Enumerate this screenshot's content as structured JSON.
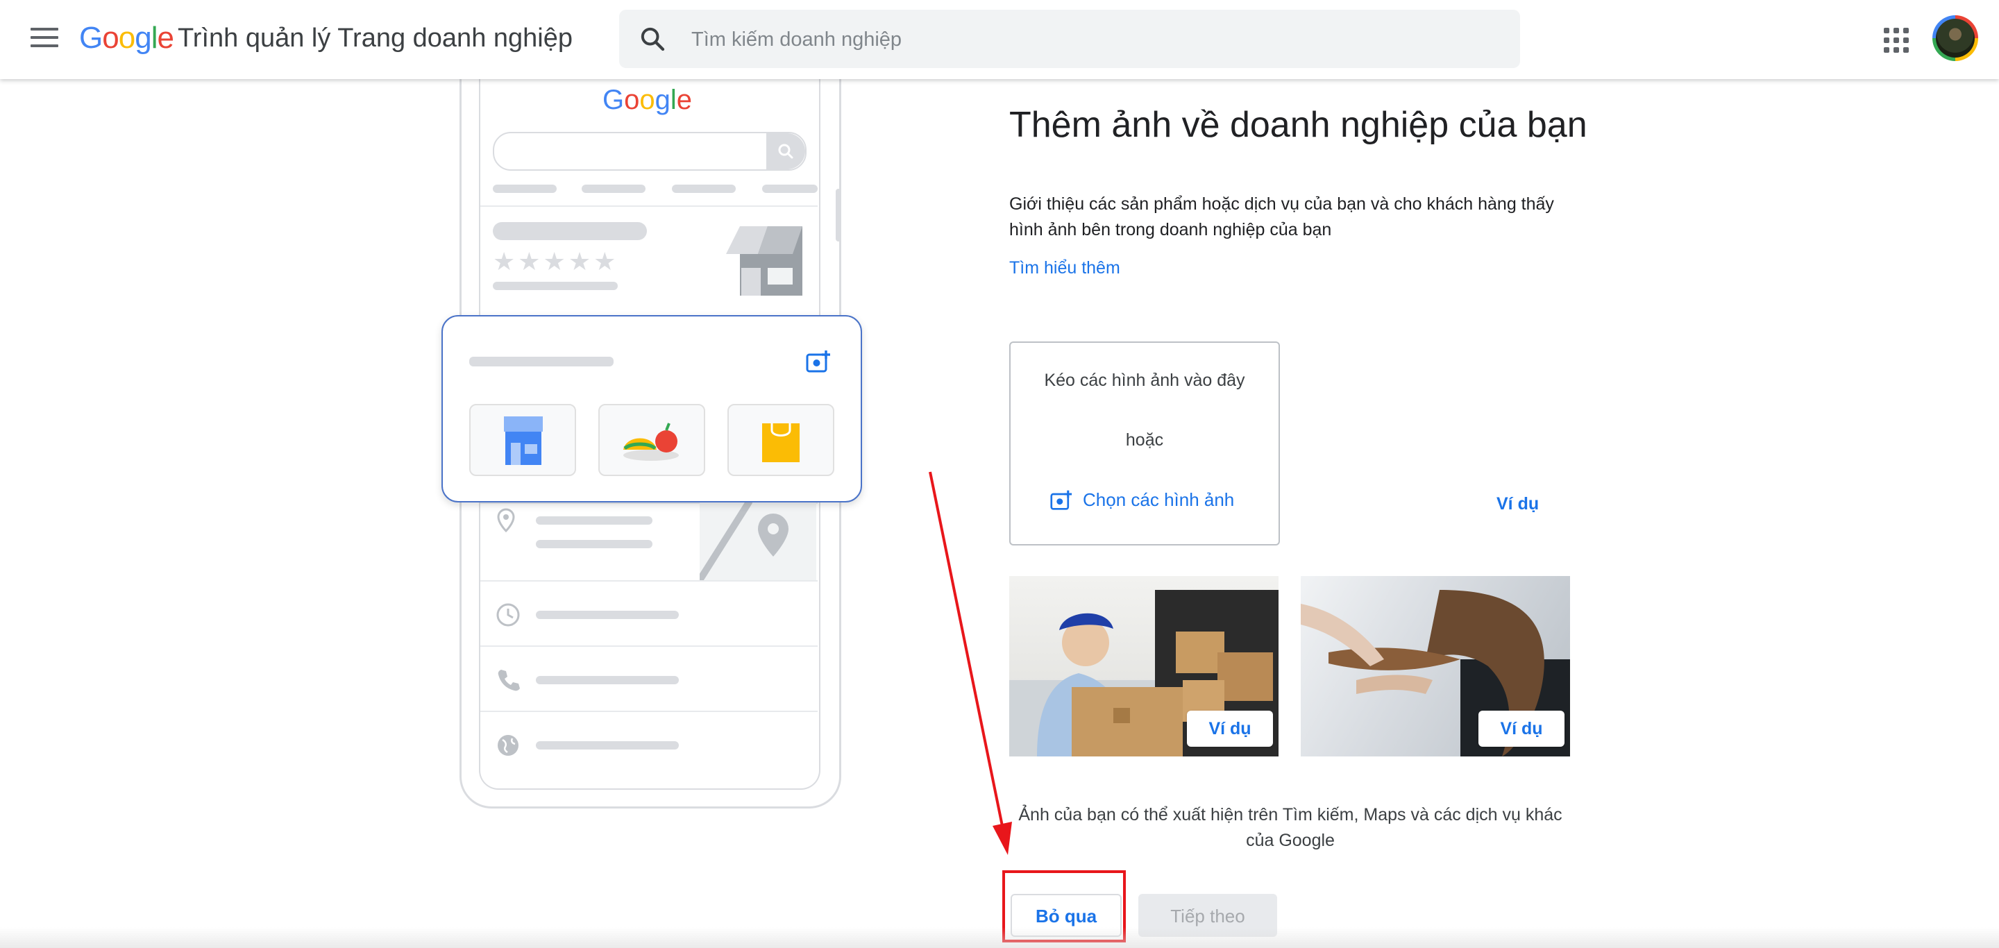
{
  "header": {
    "logo_letters": [
      "G",
      "o",
      "o",
      "g",
      "l",
      "e"
    ],
    "app_title": "Trình quản lý Trang doanh nghiệp",
    "search_placeholder": "Tìm kiếm doanh nghiệp"
  },
  "illustration": {
    "phone_logo_letters": [
      "G",
      "o",
      "o",
      "g",
      "l",
      "e"
    ],
    "stars": "★★★★★"
  },
  "main": {
    "heading": "Thêm ảnh về doanh nghiệp của bạn",
    "description": "Giới thiệu các sản phẩm hoặc dịch vụ của bạn và cho khách hàng thấy hình ảnh bên trong doanh nghiệp của bạn",
    "learn_more": "Tìm hiểu thêm",
    "drop_zone": {
      "drag_text": "Kéo các hình ảnh vào đây",
      "or_text": "hoặc",
      "choose_label": "Chọn các hình ảnh"
    },
    "example_link": "Ví dụ",
    "photo_examples": [
      {
        "button": "Ví dụ"
      },
      {
        "button": "Ví dụ"
      }
    ],
    "visibility_note": "Ảnh của bạn có thể xuất hiện trên Tìm kiếm, Maps và các dịch vụ khác của Google"
  },
  "actions": {
    "skip": "Bỏ qua",
    "next": "Tiếp theo"
  },
  "colors": {
    "accent": "#1a73e8",
    "annotation": "#e8161b",
    "google_blue": "#4285f4",
    "google_red": "#ea4335",
    "google_yellow": "#fbbc05",
    "google_green": "#34a853"
  }
}
